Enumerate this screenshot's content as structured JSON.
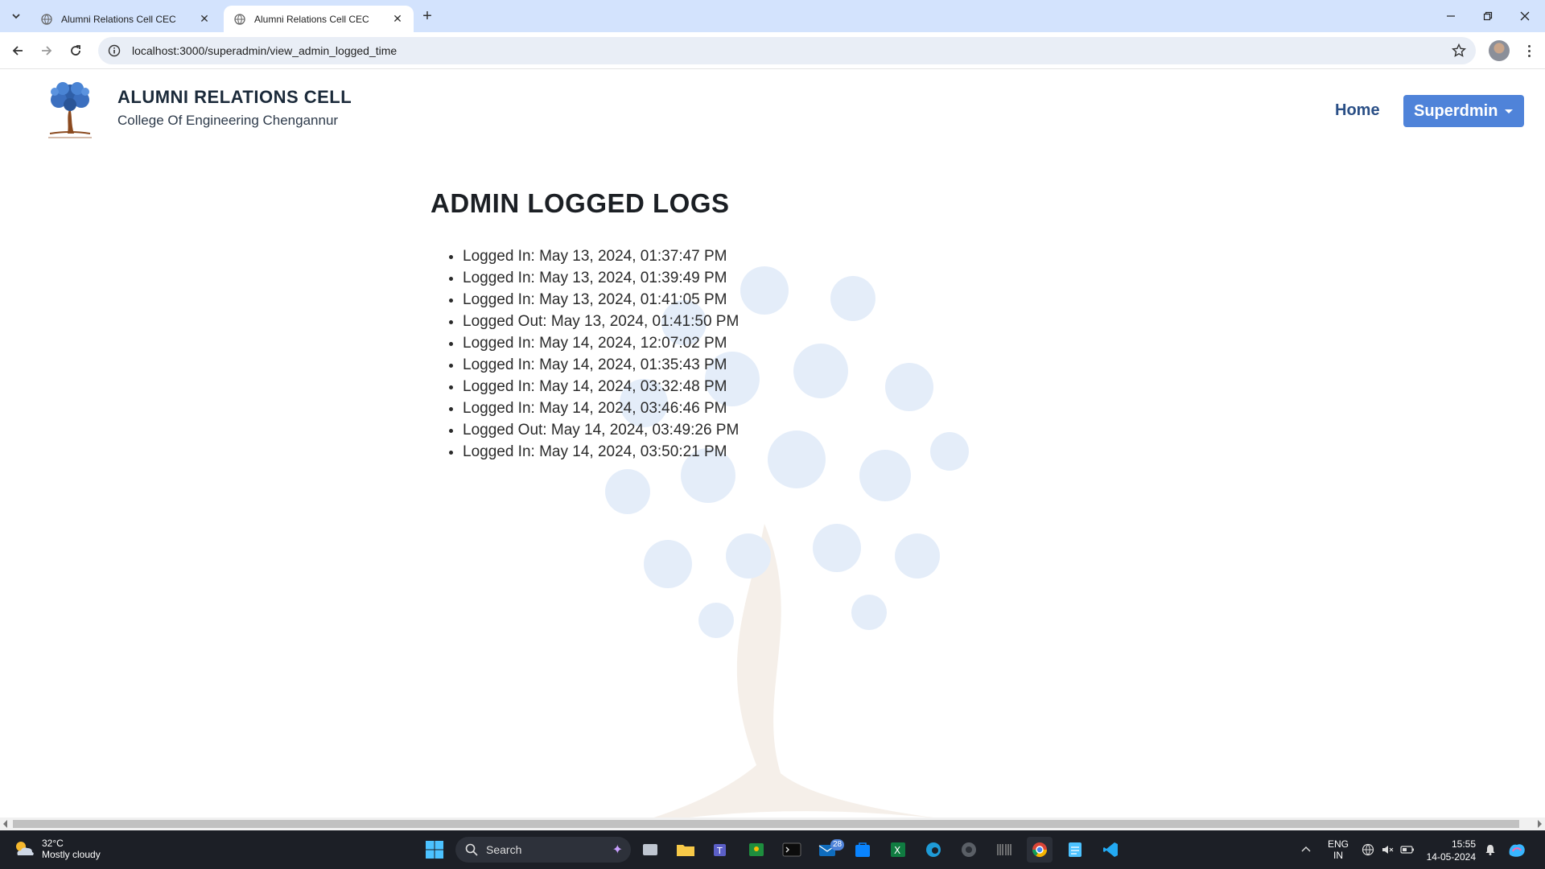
{
  "browser": {
    "tabs": [
      {
        "title": "Alumni Relations Cell CEC",
        "active": false
      },
      {
        "title": "Alumni Relations Cell CEC",
        "active": true
      }
    ],
    "url": "localhost:3000/superadmin/view_admin_logged_time"
  },
  "site": {
    "title": "ALUMNI RELATIONS CELL",
    "subtitle": "College Of Engineering Chengannur",
    "nav": {
      "home": "Home",
      "dropdown": "Superdmin"
    },
    "colors": {
      "accent": "#4f83d9",
      "nav_link": "#2a4f86"
    }
  },
  "main": {
    "heading": "ADMIN LOGGED LOGS",
    "logs": [
      "Logged In: May 13, 2024, 01:37:47 PM",
      "Logged In: May 13, 2024, 01:39:49 PM",
      "Logged In: May 13, 2024, 01:41:05 PM",
      "Logged Out: May 13, 2024, 01:41:50 PM",
      "Logged In: May 14, 2024, 12:07:02 PM",
      "Logged In: May 14, 2024, 01:35:43 PM",
      "Logged In: May 14, 2024, 03:32:48 PM",
      "Logged In: May 14, 2024, 03:46:46 PM",
      "Logged Out: May 14, 2024, 03:49:26 PM",
      "Logged In: May 14, 2024, 03:50:21 PM"
    ]
  },
  "taskbar": {
    "weather": {
      "temp": "32°C",
      "condition": "Mostly cloudy"
    },
    "search_label": "Search",
    "mail_badge": "28",
    "language": {
      "line1": "ENG",
      "line2": "IN"
    },
    "time": "15:55",
    "date": "14-05-2024"
  }
}
